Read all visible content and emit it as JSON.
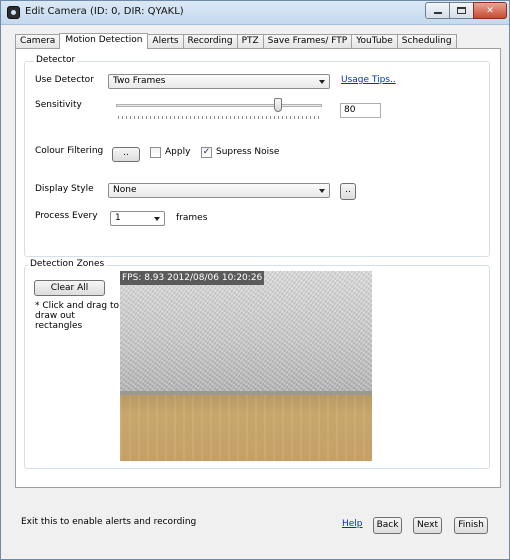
{
  "window": {
    "title": "Edit Camera (ID: 0, DIR: QYAKL)",
    "controls": {
      "minimize_icon": "minimize-icon",
      "maximize_icon": "maximize-icon",
      "close_label": "✕"
    }
  },
  "tabs": [
    {
      "label": "Camera",
      "active": false
    },
    {
      "label": "Motion Detection",
      "active": true
    },
    {
      "label": "Alerts",
      "active": false
    },
    {
      "label": "Recording",
      "active": false
    },
    {
      "label": "PTZ",
      "active": false
    },
    {
      "label": "Save Frames/ FTP",
      "active": false
    },
    {
      "label": "YouTube",
      "active": false
    },
    {
      "label": "Scheduling",
      "active": false
    }
  ],
  "detector": {
    "group_title": "Detector",
    "use_detector_label": "Use Detector",
    "use_detector_value": "Two Frames",
    "usage_tips_link": "Usage Tips..",
    "sensitivity_label": "Sensitivity",
    "sensitivity_value": "80",
    "sensitivity_fraction": 0.8,
    "colour_filtering_label": "Colour Filtering",
    "colour_button_label": "..",
    "apply_label": "Apply",
    "apply_checked": false,
    "supress_noise_label": "Supress Noise",
    "supress_noise_checked": true,
    "check_mark": "✓",
    "display_style_label": "Display Style",
    "display_style_value": "None",
    "display_style_button_label": "..",
    "process_every_label": "Process Every",
    "process_every_value": "1",
    "frames_label": "frames"
  },
  "zones": {
    "group_title": "Detection Zones",
    "clear_all_label": "Clear All",
    "hint": "* Click and drag to draw out rectangles",
    "overlay_text": "FPS: 8.93 2012/08/06 10:20:26"
  },
  "footer": {
    "status": "Exit this to enable alerts and recording",
    "help_link": "Help",
    "back_label": "Back",
    "next_label": "Next",
    "finish_label": "Finish"
  }
}
